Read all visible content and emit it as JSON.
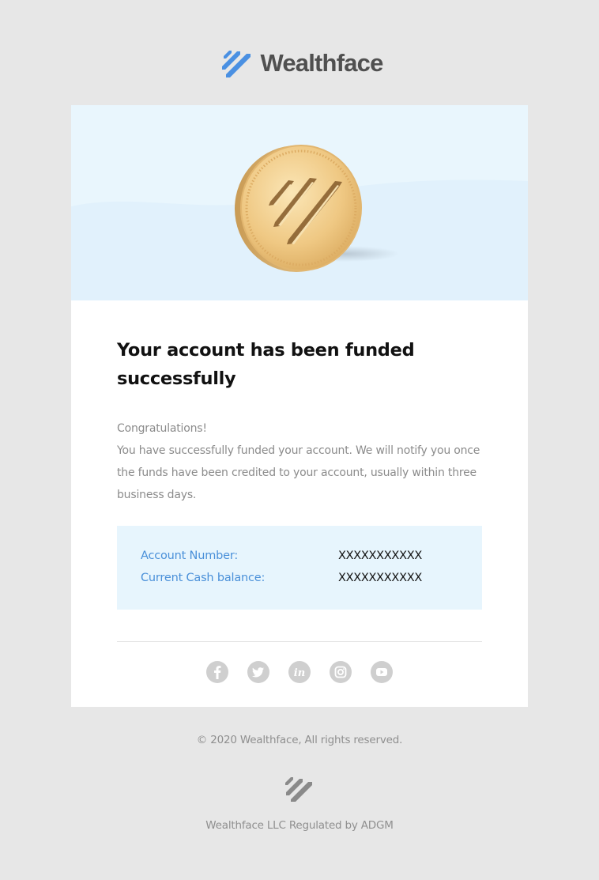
{
  "brand": {
    "name": "Wealthface",
    "logo_icon": "wealthface-stripes-logo",
    "accent_color": "#4a90e2"
  },
  "hero": {
    "image": "gold-coin-with-wealthface-logo",
    "background_color": "#e9f6fd"
  },
  "message": {
    "headline": "Your account has been funded successfully",
    "greeting": "Congratulations!",
    "body": "You have successfully funded your account. We will notify you once the funds have been credited to your account, usually within three business days."
  },
  "account_info": {
    "rows": [
      {
        "label": "Account Number:",
        "value": "XXXXXXXXXXX"
      },
      {
        "label": "Current Cash balance:",
        "value": "XXXXXXXXXXX"
      }
    ],
    "label_color": "#4a90d9",
    "background_color": "#e7f5fd"
  },
  "social_links": [
    {
      "icon": "facebook-icon"
    },
    {
      "icon": "twitter-icon"
    },
    {
      "icon": "linkedin-icon"
    },
    {
      "icon": "instagram-icon"
    },
    {
      "icon": "youtube-icon"
    }
  ],
  "footer": {
    "copyright": "© 2020 Wealthface, All rights reserved.",
    "logo_icon": "wealthface-stripes-logo-gray",
    "regulated": "Wealthface LLC Regulated by ADGM"
  }
}
